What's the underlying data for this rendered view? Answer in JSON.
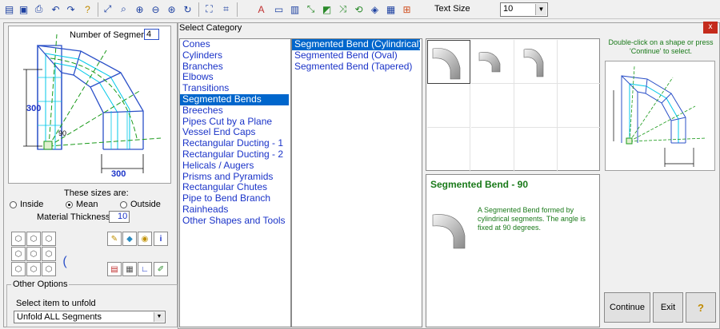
{
  "toolbar": {
    "icons": [
      "open-icon",
      "save-icon",
      "print-icon",
      "undo-icon",
      "redo-icon",
      "help-icon",
      "zoom-fit-icon",
      "zoom-window-icon",
      "zoom-in-icon",
      "zoom-out-icon",
      "zoom-extents-icon",
      "redraw-icon",
      "frame-icon",
      "select-frame-icon",
      "text-icon",
      "dimension-icon",
      "layer-icon",
      "measure-icon",
      "fill-icon",
      "pattern-icon",
      "rotate-icon",
      "view-icon",
      "grid-icon",
      "snap-icon"
    ],
    "text_size_label": "Text Size",
    "text_size_value": "10"
  },
  "left": {
    "segments_label": "Number of Segments",
    "segments_value": "4",
    "dim_height": "300",
    "dim_width": "300",
    "dim_angle": "90",
    "sizes_label": "These sizes are:",
    "radios": [
      {
        "label": "Inside",
        "checked": false
      },
      {
        "label": "Mean",
        "checked": true
      },
      {
        "label": "Outside",
        "checked": false
      }
    ],
    "material_label": "Material Thickness",
    "material_value": "10",
    "other_options_label": "Other Options",
    "unfold_label": "Select item to unfold",
    "unfold_value": "Unfold ALL Segments"
  },
  "dialog": {
    "title": "Select Category",
    "close": "x",
    "categories": [
      "Cones",
      "Cylinders",
      "Branches",
      "Elbows",
      "Transitions",
      "Segmented Bends",
      "Breeches",
      "Pipes Cut by a Plane",
      "Vessel End Caps",
      "Rectangular Ducting - 1",
      "Rectangular Ducting - 2",
      "Helicals / Augers",
      "Prisms and Pyramids",
      "Rectangular Chutes",
      "Pipe to Bend Branch",
      "Rainheads",
      "Other Shapes and Tools"
    ],
    "selected_category": 5,
    "subcategories": [
      "Segmented Bend (Cylindrical)",
      "Segmented Bend (Oval)",
      "Segmented Bend (Tapered)"
    ],
    "selected_subcategory": 0,
    "hint": "Double-click on a shape or press 'Continue' to select.",
    "desc_title": "Segmented Bend - 90",
    "desc_text": "A Segmented Bend formed by cylindrical segments.  The angle is fixed at 90 degrees.",
    "buttons": {
      "continue": "Continue",
      "exit": "Exit",
      "help": "?"
    }
  }
}
